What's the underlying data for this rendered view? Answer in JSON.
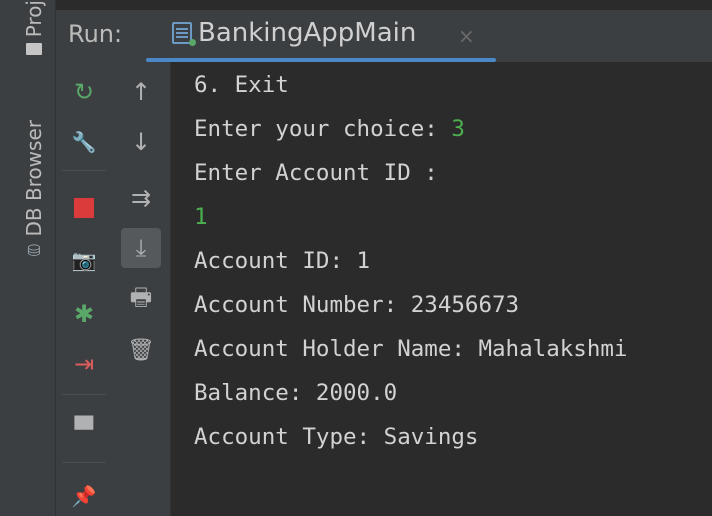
{
  "sidebar": {
    "project_tab": "Proj",
    "db_tab": "DB Browser"
  },
  "runbar": {
    "label": "Run:",
    "tab_title": "BankingAppMain",
    "close_glyph": "×"
  },
  "toolbar1": [
    {
      "name": "rerun-icon",
      "glyph": "↻"
    },
    {
      "name": "wrench-icon",
      "glyph": "🔧"
    },
    {
      "name": "stop-icon",
      "glyph": ""
    },
    {
      "name": "camera-icon",
      "glyph": "📷"
    },
    {
      "name": "debug-icon",
      "glyph": "✱"
    },
    {
      "name": "exit-icon",
      "glyph": "⇥"
    },
    {
      "name": "layout-icon",
      "glyph": "▀"
    },
    {
      "name": "pin-icon",
      "glyph": "📌"
    }
  ],
  "toolbar2": [
    {
      "name": "arrow-up-icon",
      "glyph": "↑"
    },
    {
      "name": "arrow-down-icon",
      "glyph": "↓"
    },
    {
      "name": "soft-wrap-icon",
      "glyph": "⇉"
    },
    {
      "name": "scroll-to-end-icon",
      "glyph": "⤓"
    },
    {
      "name": "print-icon",
      "glyph": "🖶"
    },
    {
      "name": "trash-icon",
      "glyph": "🗑"
    }
  ],
  "console": {
    "lines": [
      {
        "text": "6. Exit",
        "input": ""
      },
      {
        "text": "Enter your choice: ",
        "input": "3"
      },
      {
        "text": "Enter Account ID :",
        "input": ""
      },
      {
        "text": "",
        "input": "1"
      },
      {
        "text": "Account ID: 1",
        "input": ""
      },
      {
        "text": "Account Number: 23456673",
        "input": ""
      },
      {
        "text": "Account Holder Name: Mahalakshmi",
        "input": ""
      },
      {
        "text": "Balance: 2000.0",
        "input": ""
      },
      {
        "text": "Account Type: Savings",
        "input": ""
      }
    ]
  },
  "colors": {
    "user_input": "#4caf50",
    "stop": "#db3b3b",
    "tab_underline": "#4a88c7"
  }
}
